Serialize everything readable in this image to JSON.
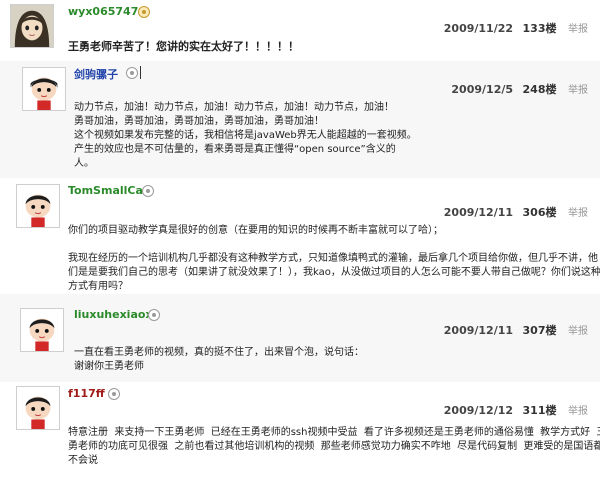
{
  "posts": [
    {
      "username": "wyx065747",
      "date": "2009/11/22",
      "floor": "133楼",
      "report": "举报",
      "lines": [
        "王勇老师辛苦了！您讲的实在太好了！！！！！"
      ]
    },
    {
      "username": "剑驹骡子",
      "date": "2009/12/5",
      "floor": "248楼",
      "report": "举报",
      "lines": [
        "动力节点，加油！动力节点，加油！动力节点，加油！动力节点，加油！",
        "勇哥加油，勇哥加油，勇哥加油，勇哥加油，勇哥加油！",
        "这个视频如果发布完整的话，我相信将是javaWeb界无人能超越的一套视频。",
        "产生的效应也是不可估量的，看来勇哥是真正懂得“open source”含义的",
        "人。"
      ]
    },
    {
      "username": "TomSmallCat",
      "date": "2009/12/11",
      "floor": "306楼",
      "report": "举报",
      "lines": [
        "你们的项目驱动教学真是很好的创意（在要用的知识的时候再不断丰富就可以了哈）；",
        "",
        "我现在经历的一个培训机构几乎都没有这种教学方式，只知道像填鸭式的灌输，最后拿几个项目给你做，但几乎不讲，他",
        "们是是要我们自己的思考（如果讲了就没效果了！），我kao，从没做过项目的人怎么可能不要人带自己做呢？你们说这种",
        "方式有用吗？"
      ]
    },
    {
      "username": "liuxuhexiaoxi",
      "date": "2009/12/11",
      "floor": "307楼",
      "report": "举报",
      "lines": [
        "一直在看王勇老师的视频，真的挺不住了，出来冒个泡，说句话：",
        "谢谢你王勇老师"
      ]
    },
    {
      "username": "f117ff",
      "date": "2009/12/12",
      "floor": "311楼",
      "report": "举报",
      "lines": [
        "特意注册  来支持一下王勇老师  已经在王勇老师的ssh视频中受益  看了许多视频还是王勇老师的通俗易懂  教学方式好  王",
        "勇老师的功底可见很强  之前也看过其他培训机构的视频  那些老师感觉功力确实不咋地  尽是代码复制  更难受的是国语都",
        "不会说"
      ]
    }
  ],
  "colors": {
    "username_green": "#2b8a2b",
    "username_blue": "#2244aa",
    "username_red": "#a01a1a",
    "report_gray": "#999999"
  },
  "icons": [
    "avatar-anime-girl",
    "avatar-cartoon-boy",
    "medal-badge-icon",
    "circle-badge-icon"
  ]
}
